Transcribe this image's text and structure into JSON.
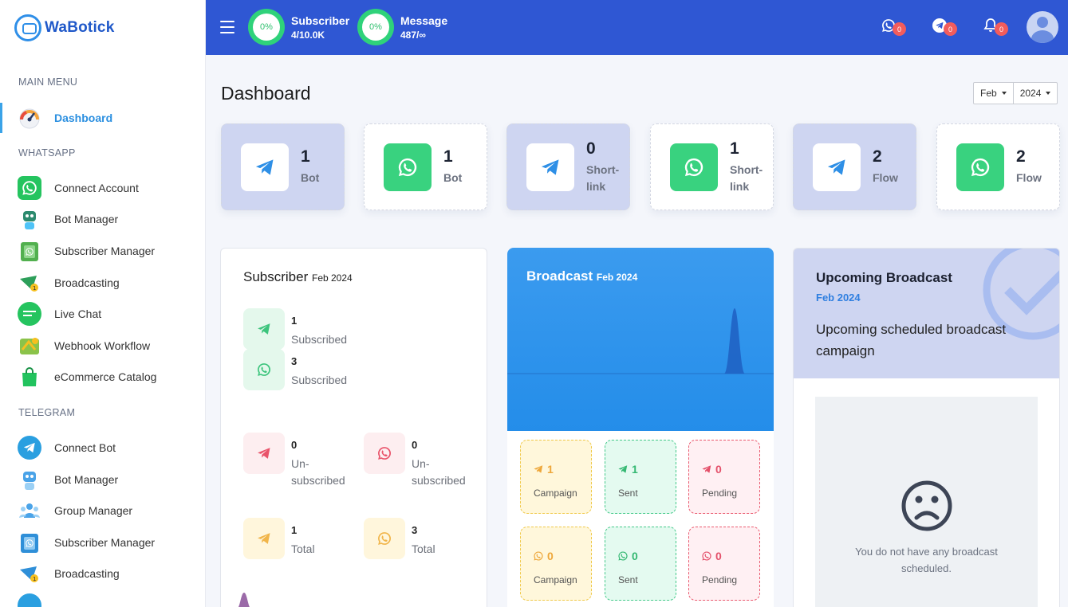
{
  "brand": {
    "name": "WaBotick"
  },
  "sidebar": {
    "main_menu_label": "MAIN MENU",
    "dashboard_label": "Dashboard",
    "whatsapp_label": "WHATSAPP",
    "whatsapp_items": [
      {
        "label": "Connect Account"
      },
      {
        "label": "Bot Manager"
      },
      {
        "label": "Subscriber Manager"
      },
      {
        "label": "Broadcasting"
      },
      {
        "label": "Live Chat"
      },
      {
        "label": "Webhook Workflow"
      },
      {
        "label": "eCommerce Catalog"
      }
    ],
    "telegram_label": "TELEGRAM",
    "telegram_items": [
      {
        "label": "Connect Bot"
      },
      {
        "label": "Bot Manager"
      },
      {
        "label": "Group Manager"
      },
      {
        "label": "Subscriber Manager"
      },
      {
        "label": "Broadcasting"
      }
    ]
  },
  "topbar": {
    "subscriber": {
      "percent": "0%",
      "title": "Subscriber",
      "value": "4/10.0K"
    },
    "message": {
      "percent": "0%",
      "title": "Message",
      "value": "487/∞"
    },
    "whatsapp_badge": "0",
    "telegram_badge": "0",
    "notification_badge": "0"
  },
  "page": {
    "title": "Dashboard",
    "month": "Feb",
    "year": "2024"
  },
  "summary_cards": [
    {
      "value": "1",
      "label": "Bot",
      "icon": "telegram-icon"
    },
    {
      "value": "1",
      "label": "Bot",
      "icon": "whatsapp-icon"
    },
    {
      "value": "0",
      "label": "Short-link",
      "icon": "telegram-icon"
    },
    {
      "value": "1",
      "label": "Short-link",
      "icon": "whatsapp-icon"
    },
    {
      "value": "2",
      "label": "Flow",
      "icon": "telegram-icon"
    },
    {
      "value": "2",
      "label": "Flow",
      "icon": "whatsapp-icon"
    }
  ],
  "subscriber_panel": {
    "title": "Subscriber",
    "period": "Feb 2024",
    "subscribed_tg": {
      "value": "1",
      "label": "Subscribed"
    },
    "subscribed_wa": {
      "value": "3",
      "label": "Subscribed"
    },
    "unsub_tg": {
      "value": "0",
      "label": "Un-subscribed"
    },
    "unsub_wa": {
      "value": "0",
      "label": "Un-subscribed"
    },
    "total_tg": {
      "value": "1",
      "label": "Total"
    },
    "total_wa": {
      "value": "3",
      "label": "Total"
    }
  },
  "broadcast_panel": {
    "title": "Broadcast",
    "period": "Feb 2024",
    "tiles": [
      {
        "value": "1",
        "label": "Campaign",
        "icon": "telegram-icon"
      },
      {
        "value": "1",
        "label": "Sent",
        "icon": "telegram-icon"
      },
      {
        "value": "0",
        "label": "Pending",
        "icon": "telegram-icon"
      },
      {
        "value": "0",
        "label": "Campaign",
        "icon": "whatsapp-icon"
      },
      {
        "value": "0",
        "label": "Sent",
        "icon": "whatsapp-icon"
      },
      {
        "value": "0",
        "label": "Pending",
        "icon": "whatsapp-icon"
      }
    ]
  },
  "upcoming_panel": {
    "title": "Upcoming Broadcast",
    "period": "Feb 2024",
    "description": "Upcoming scheduled broadcast campaign",
    "empty_message": "You do not have any broadcast scheduled."
  },
  "colors": {
    "topbar": "#2f57d3",
    "accent_blue": "#2f7fe0",
    "whatsapp_green": "#39d27f",
    "card_blue": "#ced5f1"
  }
}
